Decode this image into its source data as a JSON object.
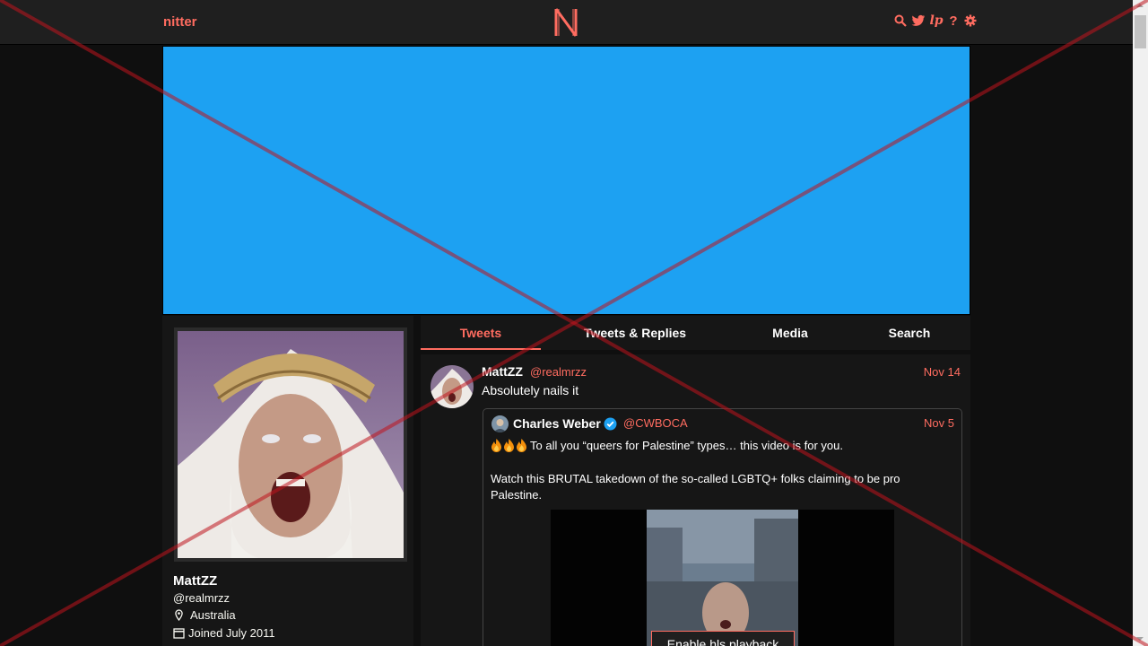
{
  "navbar": {
    "brand": "nitter",
    "icons": [
      "search-icon",
      "twitter-bird-icon",
      "lp-icon",
      "help-icon",
      "settings-gear-icon"
    ],
    "lp_label": "lp",
    "help_label": "?"
  },
  "colors": {
    "accent": "#ff6c60",
    "banner": "#1da1f2",
    "background": "#0f0f0f",
    "panel": "#161616",
    "navbar": "#1f1f1f",
    "overlay_x": "#c0141e"
  },
  "profile": {
    "name": "MattZZ",
    "handle": "@realmrzz",
    "location": "Australia",
    "joined": "Joined July 2011"
  },
  "tabs": [
    {
      "label": "Tweets",
      "active": true
    },
    {
      "label": "Tweets & Replies",
      "active": false
    },
    {
      "label": "Media",
      "active": false
    },
    {
      "label": "Search",
      "active": false
    }
  ],
  "tweet": {
    "name": "MattZZ",
    "handle": "@realmrzz",
    "date": "Nov 14",
    "text": "Absolutely nails it",
    "quote": {
      "name": "Charles Weber",
      "verified": true,
      "handle": "@CWBOCA",
      "date": "Nov 5",
      "line1": "To all you “queers for Palestine” types… this video is for you.",
      "line2": "Watch this BRUTAL takedown of the so-called LGBTQ+ folks claiming to be pro Palestine.",
      "video_button": "Enable hls playback"
    }
  }
}
